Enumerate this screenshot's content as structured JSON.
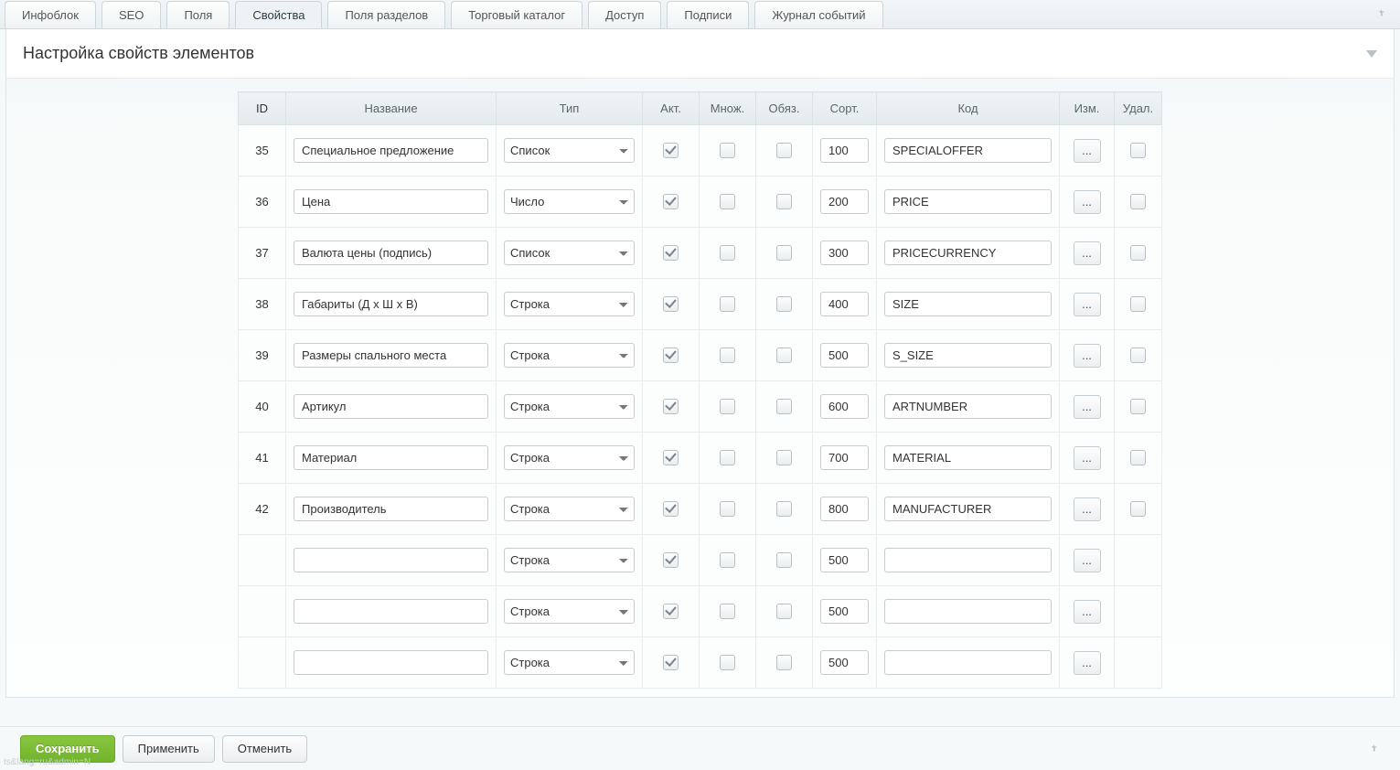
{
  "tabs": [
    "Инфоблок",
    "SEO",
    "Поля",
    "Свойства",
    "Поля разделов",
    "Торговый каталог",
    "Доступ",
    "Подписи",
    "Журнал событий"
  ],
  "active_tab": 3,
  "section_title": "Настройка свойств элементов",
  "columns": {
    "id": "ID",
    "name": "Название",
    "type": "Тип",
    "active": "Акт.",
    "multi": "Множ.",
    "req": "Обяз.",
    "sort": "Сорт.",
    "code": "Код",
    "edit": "Изм.",
    "del": "Удал."
  },
  "type_options": [
    "Строка",
    "Число",
    "Список"
  ],
  "rows": [
    {
      "id": "35",
      "name": "Специальное предложение",
      "type": "Список",
      "active": true,
      "multi": false,
      "req": false,
      "sort": "100",
      "code": "SPECIALOFFER",
      "has_del": true
    },
    {
      "id": "36",
      "name": "Цена",
      "type": "Число",
      "active": true,
      "multi": false,
      "req": false,
      "sort": "200",
      "code": "PRICE",
      "has_del": true
    },
    {
      "id": "37",
      "name": "Валюта цены (подпись)",
      "type": "Список",
      "active": true,
      "multi": false,
      "req": false,
      "sort": "300",
      "code": "PRICECURRENCY",
      "has_del": true
    },
    {
      "id": "38",
      "name": "Габариты (Д х Ш х В)",
      "type": "Строка",
      "active": true,
      "multi": false,
      "req": false,
      "sort": "400",
      "code": "SIZE",
      "has_del": true
    },
    {
      "id": "39",
      "name": "Размеры спального места",
      "type": "Строка",
      "active": true,
      "multi": false,
      "req": false,
      "sort": "500",
      "code": "S_SIZE",
      "has_del": true
    },
    {
      "id": "40",
      "name": "Артикул",
      "type": "Строка",
      "active": true,
      "multi": false,
      "req": false,
      "sort": "600",
      "code": "ARTNUMBER",
      "has_del": true
    },
    {
      "id": "41",
      "name": "Материал",
      "type": "Строка",
      "active": true,
      "multi": false,
      "req": false,
      "sort": "700",
      "code": "MATERIAL",
      "has_del": true
    },
    {
      "id": "42",
      "name": "Производитель",
      "type": "Строка",
      "active": true,
      "multi": false,
      "req": false,
      "sort": "800",
      "code": "MANUFACTURER",
      "has_del": true
    },
    {
      "id": "",
      "name": "",
      "type": "Строка",
      "active": true,
      "multi": false,
      "req": false,
      "sort": "500",
      "code": "",
      "has_del": false
    },
    {
      "id": "",
      "name": "",
      "type": "Строка",
      "active": true,
      "multi": false,
      "req": false,
      "sort": "500",
      "code": "",
      "has_del": false
    },
    {
      "id": "",
      "name": "",
      "type": "Строка",
      "active": true,
      "multi": false,
      "req": false,
      "sort": "500",
      "code": "",
      "has_del": false
    }
  ],
  "buttons": {
    "save": "Сохранить",
    "apply": "Применить",
    "cancel": "Отменить"
  },
  "ghost_text": "ts&lang=ru&admin=N",
  "dots_label": "..."
}
